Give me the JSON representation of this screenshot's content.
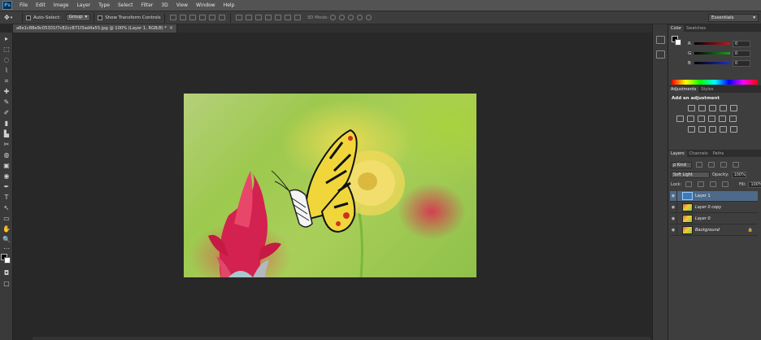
{
  "menu": {
    "logo": "Ps",
    "items": [
      "File",
      "Edit",
      "Image",
      "Layer",
      "Type",
      "Select",
      "Filter",
      "3D",
      "View",
      "Window",
      "Help"
    ]
  },
  "options": {
    "tool_icon": "move-tool-icon",
    "auto_select_label": "Auto-Select:",
    "auto_select_value": "Group",
    "show_transform_label": "Show Transform Controls",
    "mode_3d_label": "3D Mode:",
    "workspace": "Essentials"
  },
  "document": {
    "tab_title": "a8e1c88e9c05301f7c82cc871f3ad4a55.jpg @ 100% (Layer 1, RGB/8) *",
    "close": "×"
  },
  "tools": [
    "▸",
    "⬚",
    "◌",
    "⌇",
    "⌗",
    "✚",
    "✎",
    "✐",
    "▮",
    "▙",
    "✂",
    "◍",
    "▣",
    "◉",
    "✒",
    "T",
    "↖",
    "▭",
    "✋",
    "🔍",
    "⋯"
  ],
  "color_panel": {
    "tabs": [
      "Color",
      "Swatches"
    ],
    "sliders": [
      {
        "label": "R",
        "value": "0",
        "color": "#c8141e"
      },
      {
        "label": "G",
        "value": "0",
        "color": "#19a11d"
      },
      {
        "label": "B",
        "value": "0",
        "color": "#1c2fd1"
      }
    ]
  },
  "adjustments_panel": {
    "tabs": [
      "Adjustments",
      "Styles"
    ],
    "title": "Add an adjustment"
  },
  "layers_panel": {
    "tabs": [
      "Layers",
      "Channels",
      "Paths"
    ],
    "filter_value": "ρ Kind",
    "blend_mode": "Soft Light",
    "opacity_label": "Opacity:",
    "opacity_value": "100%",
    "lock_label": "Lock:",
    "fill_label": "Fill:",
    "fill_value": "100%",
    "layers": [
      {
        "name": "Layer 1",
        "selected": true
      },
      {
        "name": "Layer 0 copy",
        "selected": false
      },
      {
        "name": "Layer 0",
        "selected": false
      },
      {
        "name": "Background",
        "selected": false
      }
    ]
  }
}
